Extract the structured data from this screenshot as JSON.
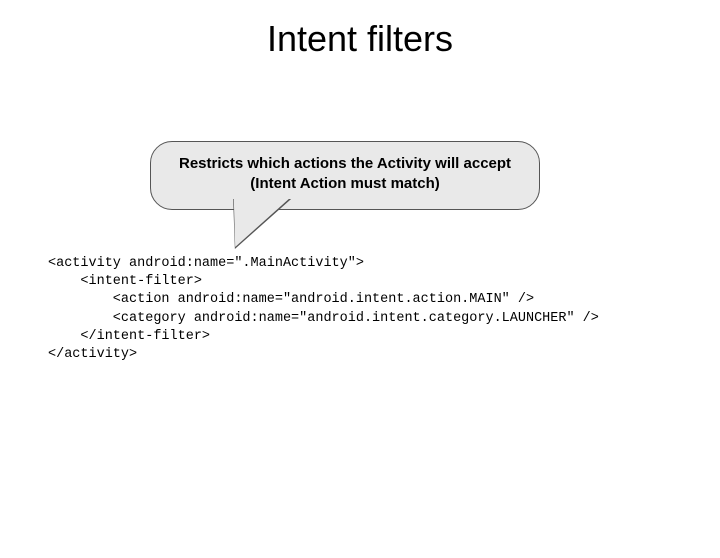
{
  "title": "Intent filters",
  "callout": {
    "line1": "Restricts which actions the Activity will accept",
    "line2": "(Intent Action must match)"
  },
  "code": {
    "l1": "<activity android:name=\".MainActivity\">",
    "l2": "    <intent-filter>",
    "l3": "        <action android:name=\"android.intent.action.MAIN\" />",
    "l4": "        <category android:name=\"android.intent.category.LAUNCHER\" />",
    "l5": "    </intent-filter>",
    "l6": "</activity>"
  }
}
